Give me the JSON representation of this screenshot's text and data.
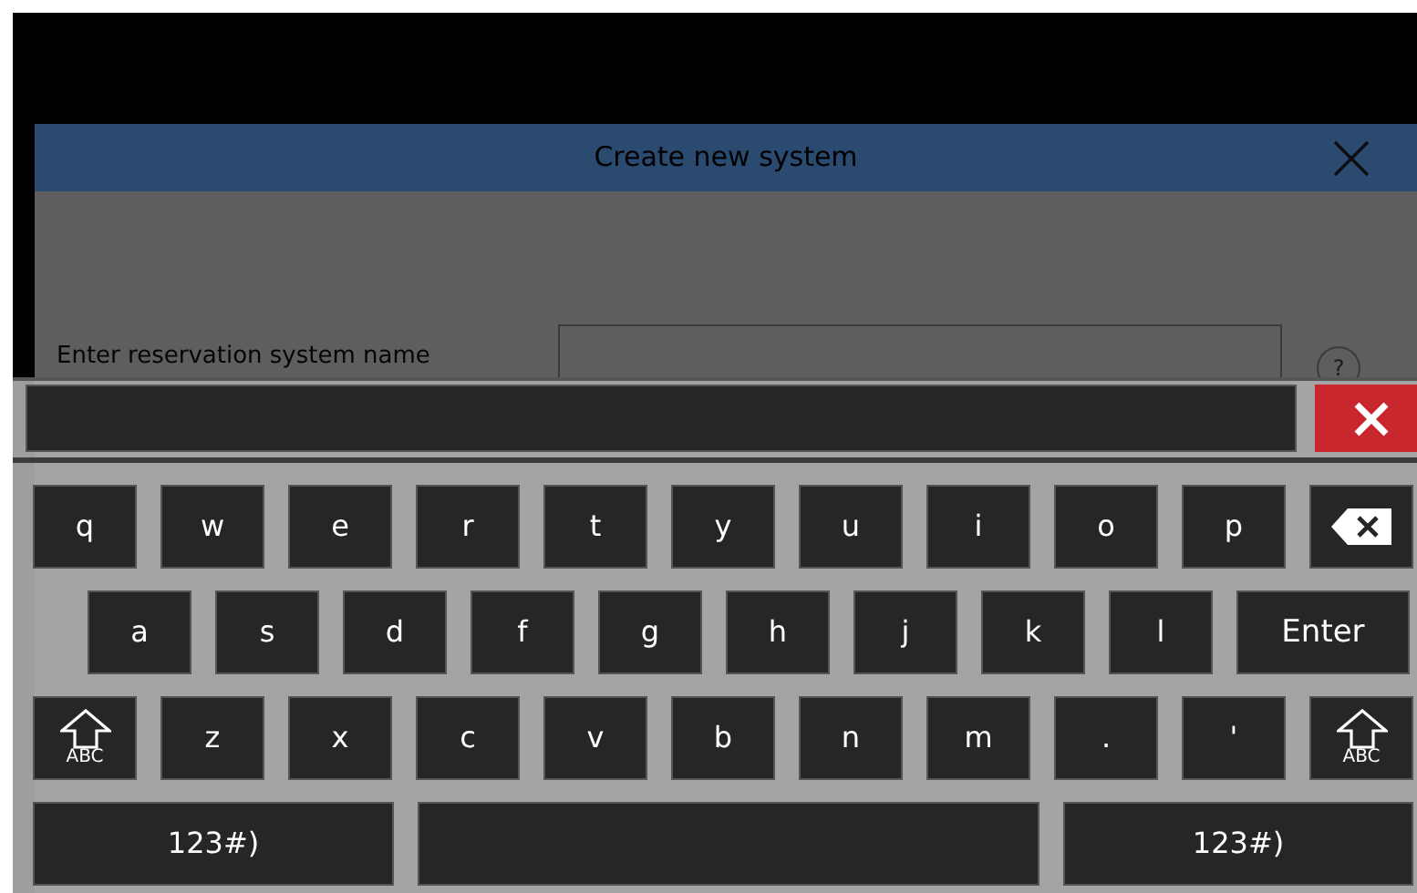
{
  "dialog": {
    "title": "Create new system",
    "name_label": "Enter reservation system name",
    "help": "?"
  },
  "keyboard": {
    "rows": [
      [
        {
          "kind": "char",
          "label": "q"
        },
        {
          "kind": "char",
          "label": "w"
        },
        {
          "kind": "char",
          "label": "e"
        },
        {
          "kind": "char",
          "label": "r"
        },
        {
          "kind": "char",
          "label": "t"
        },
        {
          "kind": "char",
          "label": "y"
        },
        {
          "kind": "char",
          "label": "u"
        },
        {
          "kind": "char",
          "label": "i"
        },
        {
          "kind": "char",
          "label": "o"
        },
        {
          "kind": "char",
          "label": "p"
        },
        {
          "kind": "backspace"
        }
      ],
      [
        {
          "kind": "char",
          "label": "a"
        },
        {
          "kind": "char",
          "label": "s"
        },
        {
          "kind": "char",
          "label": "d"
        },
        {
          "kind": "char",
          "label": "f"
        },
        {
          "kind": "char",
          "label": "g"
        },
        {
          "kind": "char",
          "label": "h"
        },
        {
          "kind": "char",
          "label": "j"
        },
        {
          "kind": "char",
          "label": "k"
        },
        {
          "kind": "char",
          "label": "l"
        },
        {
          "kind": "enter",
          "label": "Enter"
        }
      ],
      [
        {
          "kind": "shift",
          "label": "ABC"
        },
        {
          "kind": "char",
          "label": "z"
        },
        {
          "kind": "char",
          "label": "x"
        },
        {
          "kind": "char",
          "label": "c"
        },
        {
          "kind": "char",
          "label": "v"
        },
        {
          "kind": "char",
          "label": "b"
        },
        {
          "kind": "char",
          "label": "n"
        },
        {
          "kind": "char",
          "label": "m"
        },
        {
          "kind": "char",
          "label": "."
        },
        {
          "kind": "char",
          "label": "'"
        },
        {
          "kind": "shift",
          "label": "ABC"
        }
      ]
    ],
    "bottom_bar": {
      "left_key": "123#)",
      "right_key": "123#)"
    }
  }
}
